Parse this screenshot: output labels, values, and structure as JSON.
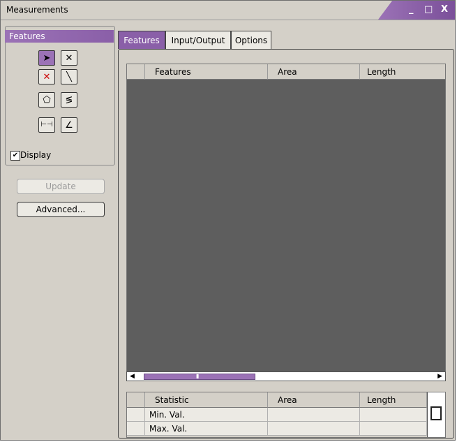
{
  "window": {
    "title": "Measurements",
    "minimize_glyph": "_",
    "maximize_glyph": "□",
    "close_glyph": "X"
  },
  "left_panel": {
    "header": "Features",
    "tools": [
      {
        "name": "select-arrow-icon",
        "glyph": "➤",
        "selected": true
      },
      {
        "name": "delete-x-icon",
        "glyph": "✕",
        "selected": false
      },
      {
        "name": "red-x-icon",
        "glyph": "✕",
        "selected": false
      },
      {
        "name": "line-icon",
        "glyph": "╲",
        "selected": false
      },
      {
        "name": "polygon-icon",
        "glyph": "⬠",
        "selected": false
      },
      {
        "name": "freehand-curve-icon",
        "glyph": "≶",
        "selected": false
      },
      {
        "name": "horizontal-distance-icon",
        "glyph": "⊢⊣",
        "selected": false
      },
      {
        "name": "angle-icon",
        "glyph": "∠",
        "selected": false
      }
    ],
    "display_label": "Display",
    "display_checked": true,
    "update_label": "Update",
    "advanced_label": "Advanced..."
  },
  "tabs": [
    {
      "label": "Features",
      "active": true
    },
    {
      "label": "Input/Output",
      "active": false
    },
    {
      "label": "Options",
      "active": false
    }
  ],
  "features_table": {
    "columns": [
      "",
      "Features",
      "Area",
      "Length"
    ]
  },
  "stats_table": {
    "columns": [
      "",
      "Statistic",
      "Area",
      "Length"
    ],
    "rows": [
      [
        "",
        "Min. Val.",
        "",
        ""
      ],
      [
        "",
        "Max. Val.",
        "",
        ""
      ]
    ]
  },
  "scrollbar_glyphs": {
    "left": "◀",
    "right": "▶",
    "thumb_grip": "▮"
  }
}
